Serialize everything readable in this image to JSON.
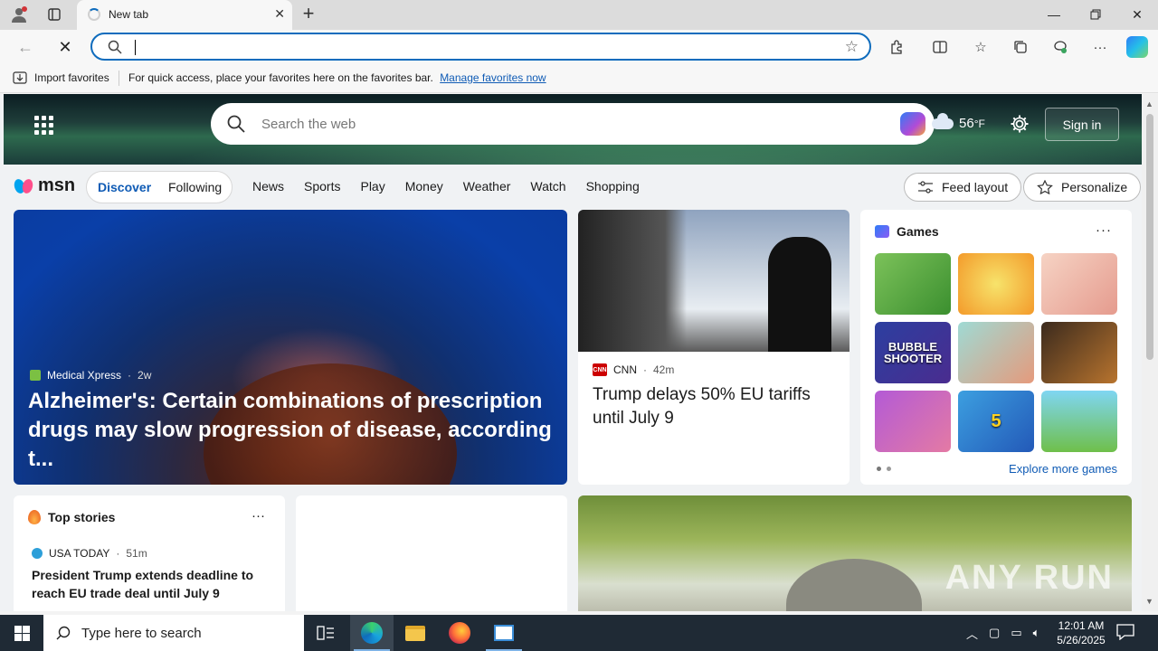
{
  "browser": {
    "tab_title": "New tab",
    "address_value": "",
    "favorites_bar": {
      "import_label": "Import favorites",
      "hint_text": "For quick access, place your favorites here on the favorites bar.",
      "manage_link": "Manage favorites now"
    }
  },
  "msn": {
    "search_placeholder": "Search the web",
    "weather_temp": "56",
    "weather_unit": "°F",
    "sign_in": "Sign in",
    "logo_text": "msn",
    "feed_tabs": {
      "discover": "Discover",
      "following": "Following"
    },
    "nav_links": [
      "News",
      "Sports",
      "Play",
      "Money",
      "Weather",
      "Watch",
      "Shopping"
    ],
    "feed_layout_btn": "Feed layout",
    "personalize_btn": "Personalize"
  },
  "cards": {
    "hero": {
      "source": "Medical Xpress",
      "age": "2w",
      "title": "Alzheimer's: Certain combinations of prescription drugs may slow progression of disease, according t..."
    },
    "cnn": {
      "source": "CNN",
      "age": "42m",
      "title": "Trump delays 50% EU tariffs until July 9"
    },
    "games": {
      "title": "Games",
      "more": "···",
      "tiles": [
        "",
        "",
        "",
        "BUBBLE SHOOTER",
        "",
        "",
        "",
        "5",
        ""
      ],
      "explore": "Explore more games"
    },
    "top_stories": {
      "title": "Top stories",
      "more": "···",
      "source": "USA TODAY",
      "age": "51m",
      "title_text": "President Trump extends deadline to reach EU trade deal until July 9"
    },
    "photo_watermark": "ANY RUN"
  },
  "taskbar": {
    "search_placeholder": "Type here to search",
    "time": "12:01 AM",
    "date": "5/26/2025"
  },
  "colors": {
    "accent": "#0f6cbd",
    "link": "#0f5bb5",
    "taskbar": "#1f2a35"
  }
}
